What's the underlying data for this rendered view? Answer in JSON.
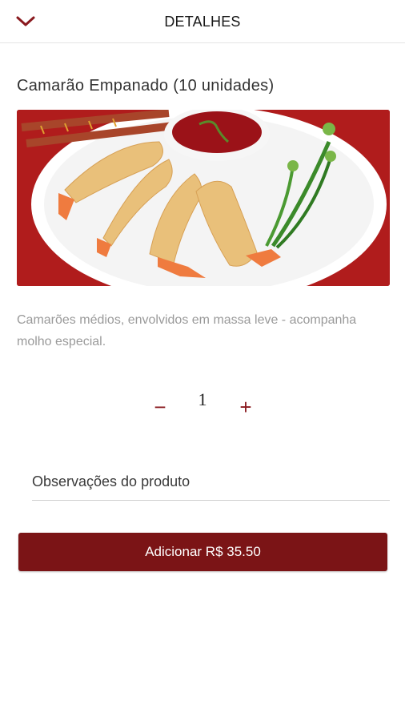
{
  "header": {
    "title": "DETALHES",
    "back_icon": "chevron-down-icon"
  },
  "product": {
    "name": "Camarão Empanado (10 unidades)",
    "description": "Camarões médios, envolvidos em massa leve - acompanha molho especial."
  },
  "quantity": {
    "minus_label": "−",
    "value": "1",
    "plus_label": "+"
  },
  "notes": {
    "placeholder": "Observações do produto",
    "value": ""
  },
  "actions": {
    "add_label": "Adicionar R$ 35.50"
  },
  "colors": {
    "accent": "#7b1416",
    "icon": "#8a1a1f",
    "description_text": "#9a9a9a"
  }
}
